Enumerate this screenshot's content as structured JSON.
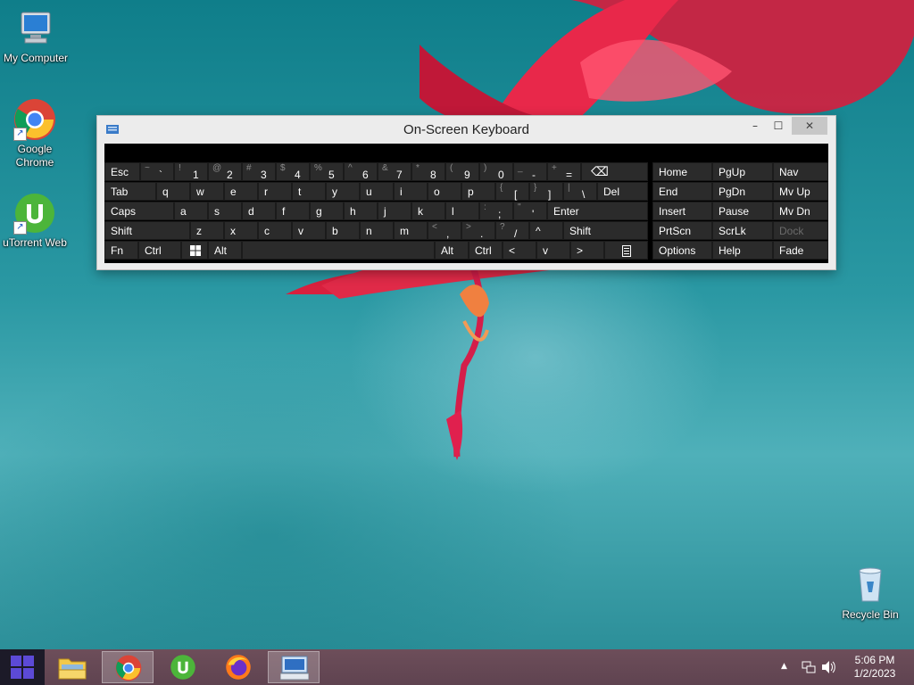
{
  "desktop": {
    "icons": [
      {
        "label": "My Computer"
      },
      {
        "label": "Google Chrome"
      },
      {
        "label": "uTorrent Web"
      },
      {
        "label": "Recycle Bin"
      }
    ]
  },
  "osk": {
    "title": "On-Screen Keyboard",
    "controls": {
      "minimize": "–",
      "maximize": "☐",
      "close": "✕"
    },
    "row1": {
      "esc": "Esc",
      "keys": [
        {
          "s": "~",
          "b": "`"
        },
        {
          "s": "!",
          "b": "1"
        },
        {
          "s": "@",
          "b": "2"
        },
        {
          "s": "#",
          "b": "3"
        },
        {
          "s": "$",
          "b": "4"
        },
        {
          "s": "%",
          "b": "5"
        },
        {
          "s": "^",
          "b": "6"
        },
        {
          "s": "&",
          "b": "7"
        },
        {
          "s": "*",
          "b": "8"
        },
        {
          "s": "(",
          "b": "9"
        },
        {
          "s": ")",
          "b": "0"
        },
        {
          "s": "_",
          "b": "-"
        },
        {
          "s": "+",
          "b": "="
        }
      ],
      "backspace": "⌫"
    },
    "row2": {
      "tab": "Tab",
      "letters": [
        "q",
        "w",
        "e",
        "r",
        "t",
        "y",
        "u",
        "i",
        "o",
        "p"
      ],
      "brackets": [
        {
          "s": "{",
          "b": "["
        },
        {
          "s": "}",
          "b": "]"
        },
        {
          "s": "|",
          "b": "\\"
        }
      ],
      "del": "Del"
    },
    "row3": {
      "caps": "Caps",
      "letters": [
        "a",
        "s",
        "d",
        "f",
        "g",
        "h",
        "j",
        "k",
        "l"
      ],
      "punct": [
        {
          "s": ":",
          "b": ";"
        },
        {
          "s": "\"",
          "b": "'"
        }
      ],
      "enter": "Enter"
    },
    "row4": {
      "shift_left": "Shift",
      "letters": [
        "z",
        "x",
        "c",
        "v",
        "b",
        "n",
        "m"
      ],
      "punct": [
        {
          "s": "<",
          "b": ","
        },
        {
          "s": ">",
          "b": "."
        },
        {
          "s": "?",
          "b": "/"
        }
      ],
      "up": "^",
      "shift_right": "Shift"
    },
    "row5": {
      "fn": "Fn",
      "ctrl_left": "Ctrl",
      "alt_left": "Alt",
      "alt_right": "Alt",
      "ctrl_right": "Ctrl",
      "left": "<",
      "down": "v",
      "right": ">"
    },
    "right_block": {
      "home": "Home",
      "pgup": "PgUp",
      "nav": "Nav",
      "end": "End",
      "pgdn": "PgDn",
      "mvup": "Mv Up",
      "insert": "Insert",
      "pause": "Pause",
      "mvdn": "Mv Dn",
      "prtscn": "PrtScn",
      "scrlk": "ScrLk",
      "dock": "Dock",
      "options": "Options",
      "help": "Help",
      "fade": "Fade"
    }
  },
  "taskbar": {
    "clock_time": "5:06 PM",
    "clock_date": "1/2/2023",
    "tray_chevron": "▲"
  },
  "colors": {
    "osk_key_bg": "#2b2b2b",
    "osk_frame": "#ececec",
    "taskbar": "#6d4e5a",
    "start_button": "#1c1a28"
  }
}
